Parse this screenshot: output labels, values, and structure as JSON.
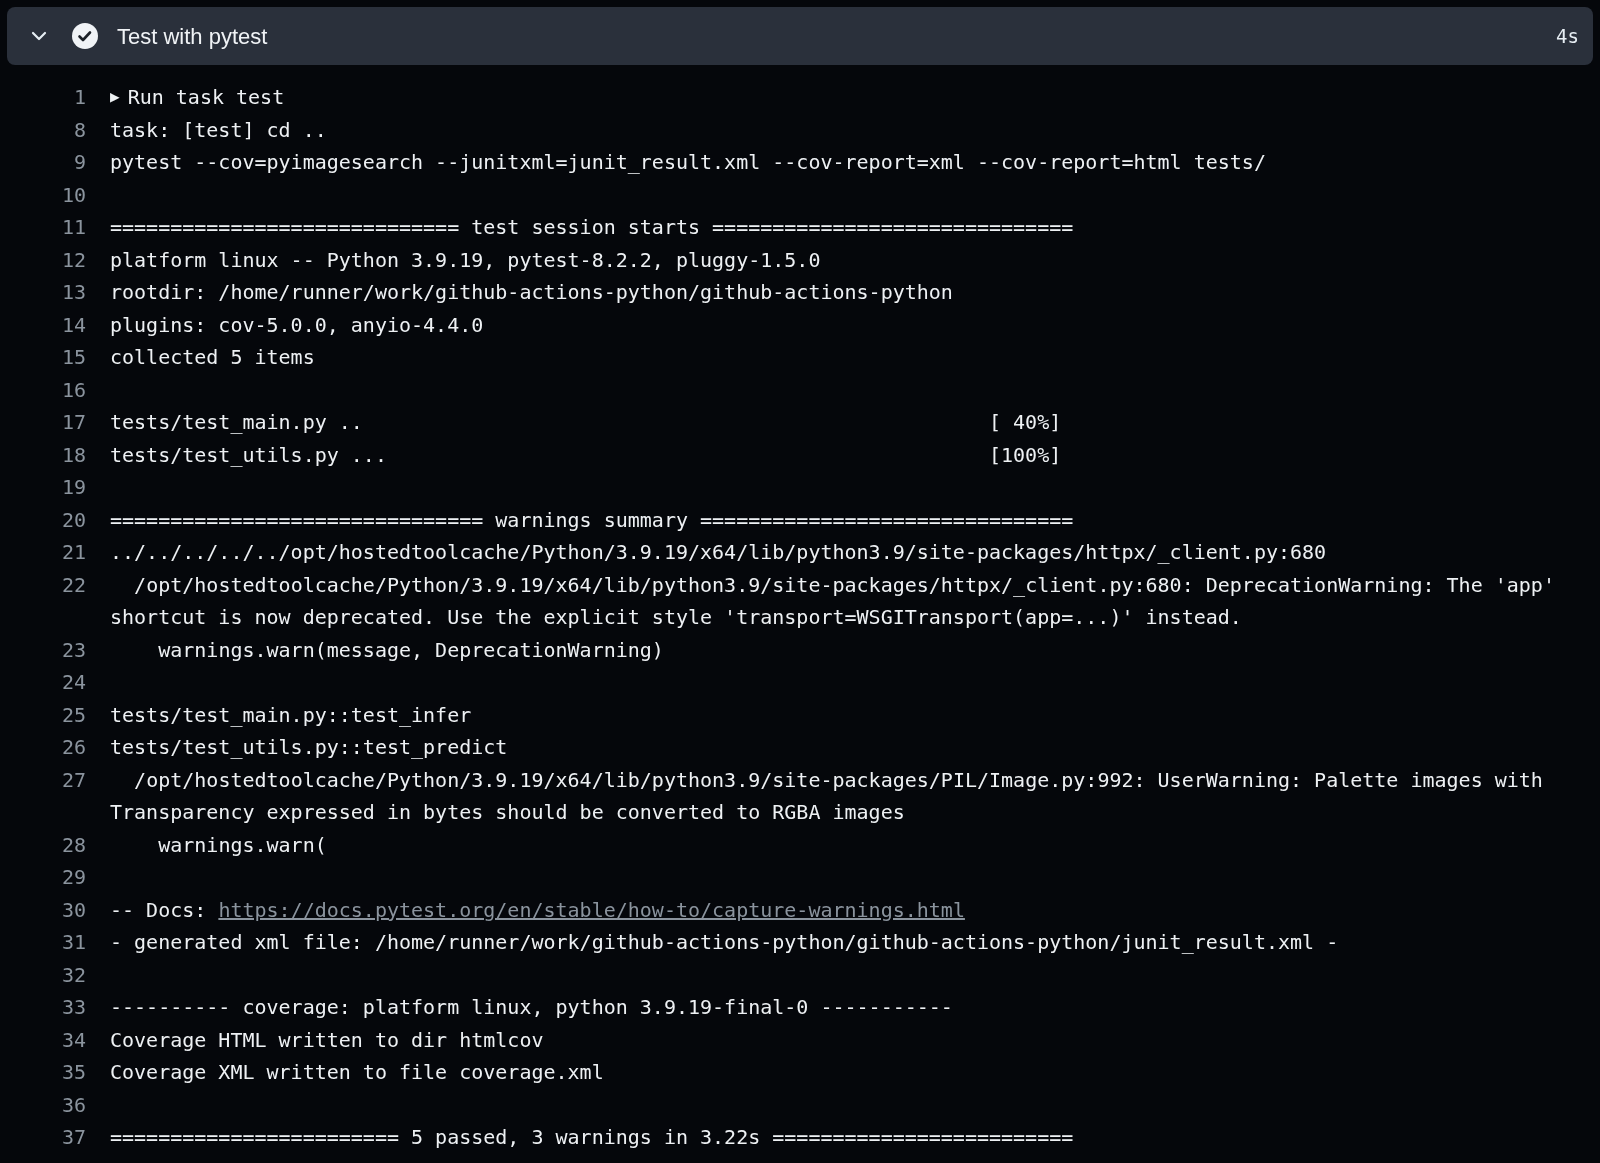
{
  "step": {
    "title": "Test with pytest",
    "duration": "4s",
    "succeeded": true,
    "expanded": true
  },
  "lines": [
    {
      "number": "1",
      "toggle": "▶",
      "text": "Run task test"
    },
    {
      "number": "8",
      "text": "task: [test] cd .."
    },
    {
      "number": "9",
      "text": "pytest --cov=pyimagesearch --junitxml=junit_result.xml --cov-report=xml --cov-report=html tests/"
    },
    {
      "number": "10"
    },
    {
      "number": "11",
      "text": "============================= test session starts =============================="
    },
    {
      "number": "12",
      "text": "platform linux -- Python 3.9.19, pytest-8.2.2, pluggy-1.5.0"
    },
    {
      "number": "13",
      "text": "rootdir: /home/runner/work/github-actions-python/github-actions-python"
    },
    {
      "number": "14",
      "text": "plugins: cov-5.0.0, anyio-4.4.0"
    },
    {
      "number": "15",
      "text": "collected 5 items"
    },
    {
      "number": "16"
    },
    {
      "number": "17",
      "text": "tests/test_main.py ..                                                    [ 40%]"
    },
    {
      "number": "18",
      "text": "tests/test_utils.py ...                                                  [100%]"
    },
    {
      "number": "19"
    },
    {
      "number": "20",
      "text": "=============================== warnings summary ==============================="
    },
    {
      "number": "21",
      "text": "../../../../../opt/hostedtoolcache/Python/3.9.19/x64/lib/python3.9/site-packages/httpx/_client.py:680"
    },
    {
      "number": "22",
      "text": "  /opt/hostedtoolcache/Python/3.9.19/x64/lib/python3.9/site-packages/httpx/_client.py:680: DeprecationWarning: The 'app' shortcut is now deprecated. Use the explicit style 'transport=WSGITransport(app=...)' instead."
    },
    {
      "number": "23",
      "text": "    warnings.warn(message, DeprecationWarning)"
    },
    {
      "number": "24"
    },
    {
      "number": "25",
      "text": "tests/test_main.py::test_infer"
    },
    {
      "number": "26",
      "text": "tests/test_utils.py::test_predict"
    },
    {
      "number": "27",
      "text": "  /opt/hostedtoolcache/Python/3.9.19/x64/lib/python3.9/site-packages/PIL/Image.py:992: UserWarning: Palette images with Transparency expressed in bytes should be converted to RGBA images"
    },
    {
      "number": "28",
      "text": "    warnings.warn("
    },
    {
      "number": "29"
    },
    {
      "number": "30",
      "text": "-- Docs: ",
      "link": "https://docs.pytest.org/en/stable/how-to/capture-warnings.html"
    },
    {
      "number": "31",
      "text": "- generated xml file: /home/runner/work/github-actions-python/github-actions-python/junit_result.xml -"
    },
    {
      "number": "32"
    },
    {
      "number": "33",
      "text": "---------- coverage: platform linux, python 3.9.19-final-0 -----------"
    },
    {
      "number": "34",
      "text": "Coverage HTML written to dir htmlcov"
    },
    {
      "number": "35",
      "text": "Coverage XML written to file coverage.xml"
    },
    {
      "number": "36"
    },
    {
      "number": "37",
      "text": "======================== 5 passed, 3 warnings in 3.22s ========================="
    }
  ]
}
